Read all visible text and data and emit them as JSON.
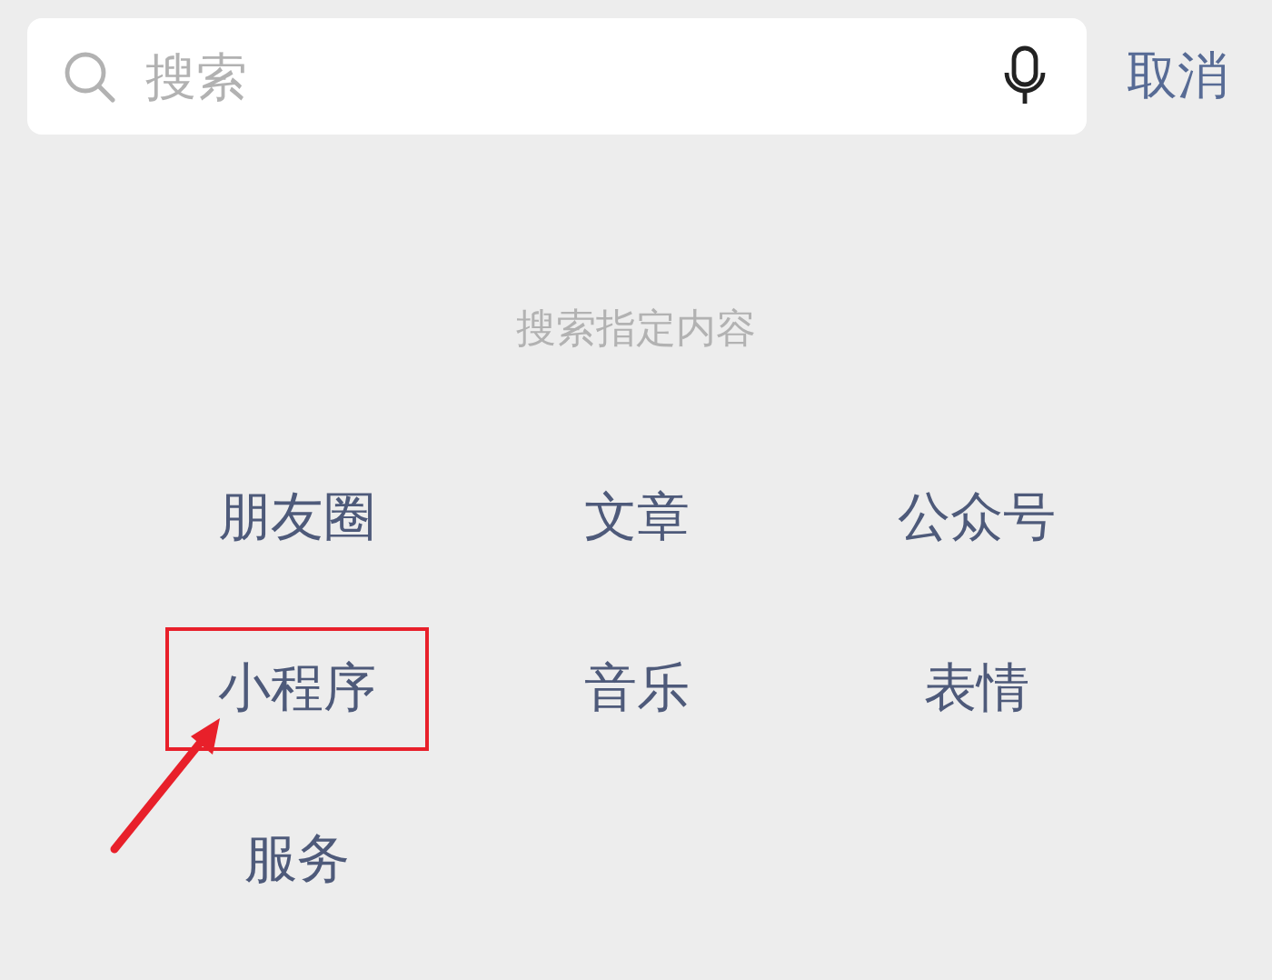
{
  "search": {
    "placeholder": "搜索"
  },
  "cancel": "取消",
  "section_title": "搜索指定内容",
  "categories": [
    {
      "label": "朋友圈",
      "highlighted": false
    },
    {
      "label": "文章",
      "highlighted": false
    },
    {
      "label": "公众号",
      "highlighted": false
    },
    {
      "label": "小程序",
      "highlighted": true
    },
    {
      "label": "音乐",
      "highlighted": false
    },
    {
      "label": "表情",
      "highlighted": false
    },
    {
      "label": "服务",
      "highlighted": false
    }
  ]
}
